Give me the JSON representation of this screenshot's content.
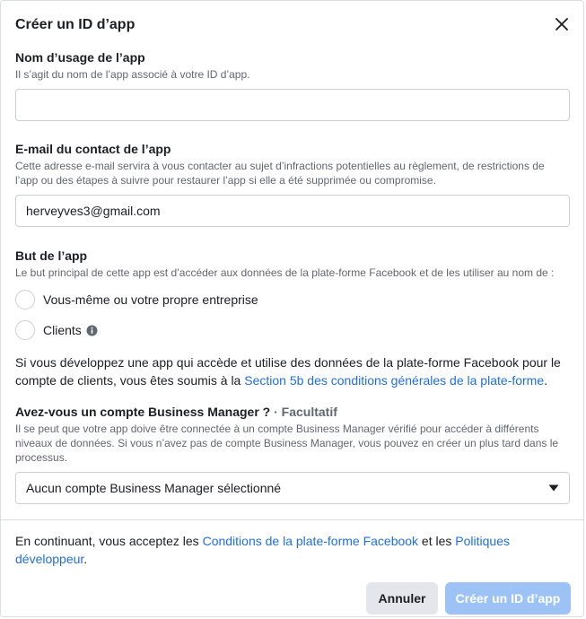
{
  "dialog": {
    "title": "Créer un ID d’app",
    "close_icon": "close-icon"
  },
  "app_name": {
    "label": "Nom d’usage de l’app",
    "help": "Il s’agit du nom de l’app associé à votre ID d’app.",
    "value": ""
  },
  "contact_email": {
    "label": "E-mail du contact de l’app",
    "help": "Cette adresse e-mail servira à vous contacter au sujet d’infractions potentielles au règlement, de restrictions de l’app ou des étapes à suivre pour restaurer l’app si elle a été supprimée ou compromise.",
    "value": "herveyves3@gmail.com"
  },
  "purpose": {
    "label": "But de l’app",
    "help": "Le but principal de cette app est d’accéder aux données de la plate-forme Facebook et de les utiliser au nom de :",
    "options": [
      {
        "label": "Vous-même ou votre propre entreprise"
      },
      {
        "label": "Clients",
        "icon": "info-icon"
      }
    ],
    "notice_text": "Si vous développez une app qui accède et utilise des données de la plate-forme Facebook pour le compte de clients, vous êtes soumis à la ",
    "notice_link": "Section 5b des conditions générales de la plate-forme",
    "notice_end": "."
  },
  "business_manager": {
    "label": "Avez-vous un compte Business Manager ?",
    "optional": " · Facultatif",
    "help": "Il se peut que votre app doive être connectée à un compte Business Manager vérifié pour accéder à différents niveaux de données. Si vous n’avez pas de compte Business Manager, vous pouvez en créer un plus tard dans le processus.",
    "selected": "Aucun compte Business Manager sélectionné",
    "dropdown_icon": "caret-down-icon"
  },
  "footer": {
    "text_before": "En continuant, vous acceptez les ",
    "link1": "Conditions de la plate-forme Facebook",
    "text_middle": " et les ",
    "link2": "Politiques développeur",
    "text_end": "."
  },
  "buttons": {
    "cancel": "Annuler",
    "create": "Créer un ID d’app"
  },
  "colors": {
    "link": "#216fdb",
    "primary_disabled": "#9cc2f6",
    "secondary": "#e4e6eb"
  }
}
